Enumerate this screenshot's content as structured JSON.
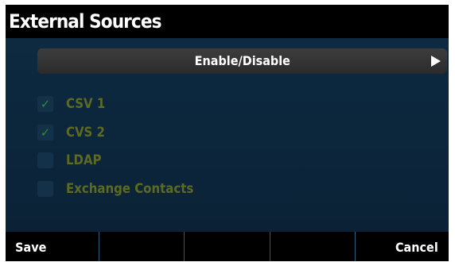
{
  "window": {
    "title": "External Sources"
  },
  "menu": {
    "enable_disable_label": "Enable/Disable",
    "arrow_icon": "right-arrow-icon"
  },
  "sources": [
    {
      "label": "CSV 1",
      "checked": true
    },
    {
      "label": "CVS 2",
      "checked": true
    },
    {
      "label": "LDAP",
      "checked": false
    },
    {
      "label": "Exchange Contacts",
      "checked": false
    }
  ],
  "softkeys": {
    "key1": "Save",
    "key2": "",
    "key3": "",
    "key4": "",
    "key5": "Cancel"
  },
  "colors": {
    "background": "#0b2236",
    "titlebar": "#000000",
    "item_text": "#5d6b22",
    "check": "#2f8a3a"
  }
}
